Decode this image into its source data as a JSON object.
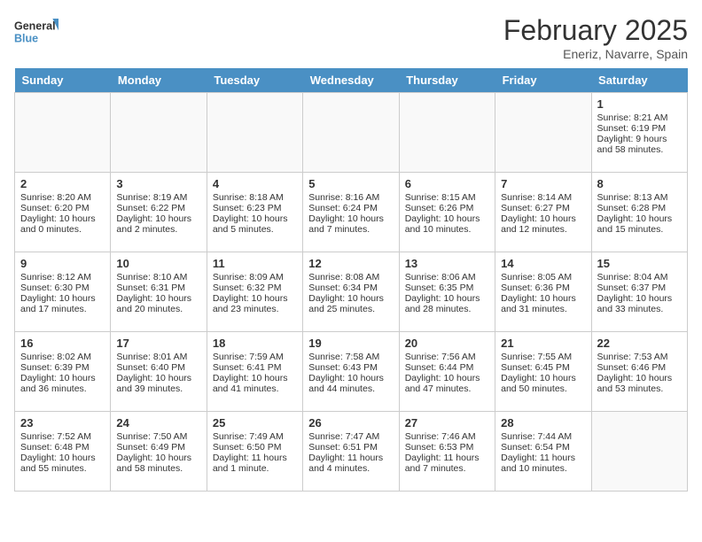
{
  "logo": {
    "line1": "General",
    "line2": "Blue"
  },
  "title": "February 2025",
  "subtitle": "Eneriz, Navarre, Spain",
  "days_of_week": [
    "Sunday",
    "Monday",
    "Tuesday",
    "Wednesday",
    "Thursday",
    "Friday",
    "Saturday"
  ],
  "weeks": [
    [
      {
        "day": "",
        "info": ""
      },
      {
        "day": "",
        "info": ""
      },
      {
        "day": "",
        "info": ""
      },
      {
        "day": "",
        "info": ""
      },
      {
        "day": "",
        "info": ""
      },
      {
        "day": "",
        "info": ""
      },
      {
        "day": "1",
        "info": "Sunrise: 8:21 AM\nSunset: 6:19 PM\nDaylight: 9 hours\nand 58 minutes."
      }
    ],
    [
      {
        "day": "2",
        "info": "Sunrise: 8:20 AM\nSunset: 6:20 PM\nDaylight: 10 hours\nand 0 minutes."
      },
      {
        "day": "3",
        "info": "Sunrise: 8:19 AM\nSunset: 6:22 PM\nDaylight: 10 hours\nand 2 minutes."
      },
      {
        "day": "4",
        "info": "Sunrise: 8:18 AM\nSunset: 6:23 PM\nDaylight: 10 hours\nand 5 minutes."
      },
      {
        "day": "5",
        "info": "Sunrise: 8:16 AM\nSunset: 6:24 PM\nDaylight: 10 hours\nand 7 minutes."
      },
      {
        "day": "6",
        "info": "Sunrise: 8:15 AM\nSunset: 6:26 PM\nDaylight: 10 hours\nand 10 minutes."
      },
      {
        "day": "7",
        "info": "Sunrise: 8:14 AM\nSunset: 6:27 PM\nDaylight: 10 hours\nand 12 minutes."
      },
      {
        "day": "8",
        "info": "Sunrise: 8:13 AM\nSunset: 6:28 PM\nDaylight: 10 hours\nand 15 minutes."
      }
    ],
    [
      {
        "day": "9",
        "info": "Sunrise: 8:12 AM\nSunset: 6:30 PM\nDaylight: 10 hours\nand 17 minutes."
      },
      {
        "day": "10",
        "info": "Sunrise: 8:10 AM\nSunset: 6:31 PM\nDaylight: 10 hours\nand 20 minutes."
      },
      {
        "day": "11",
        "info": "Sunrise: 8:09 AM\nSunset: 6:32 PM\nDaylight: 10 hours\nand 23 minutes."
      },
      {
        "day": "12",
        "info": "Sunrise: 8:08 AM\nSunset: 6:34 PM\nDaylight: 10 hours\nand 25 minutes."
      },
      {
        "day": "13",
        "info": "Sunrise: 8:06 AM\nSunset: 6:35 PM\nDaylight: 10 hours\nand 28 minutes."
      },
      {
        "day": "14",
        "info": "Sunrise: 8:05 AM\nSunset: 6:36 PM\nDaylight: 10 hours\nand 31 minutes."
      },
      {
        "day": "15",
        "info": "Sunrise: 8:04 AM\nSunset: 6:37 PM\nDaylight: 10 hours\nand 33 minutes."
      }
    ],
    [
      {
        "day": "16",
        "info": "Sunrise: 8:02 AM\nSunset: 6:39 PM\nDaylight: 10 hours\nand 36 minutes."
      },
      {
        "day": "17",
        "info": "Sunrise: 8:01 AM\nSunset: 6:40 PM\nDaylight: 10 hours\nand 39 minutes."
      },
      {
        "day": "18",
        "info": "Sunrise: 7:59 AM\nSunset: 6:41 PM\nDaylight: 10 hours\nand 41 minutes."
      },
      {
        "day": "19",
        "info": "Sunrise: 7:58 AM\nSunset: 6:43 PM\nDaylight: 10 hours\nand 44 minutes."
      },
      {
        "day": "20",
        "info": "Sunrise: 7:56 AM\nSunset: 6:44 PM\nDaylight: 10 hours\nand 47 minutes."
      },
      {
        "day": "21",
        "info": "Sunrise: 7:55 AM\nSunset: 6:45 PM\nDaylight: 10 hours\nand 50 minutes."
      },
      {
        "day": "22",
        "info": "Sunrise: 7:53 AM\nSunset: 6:46 PM\nDaylight: 10 hours\nand 53 minutes."
      }
    ],
    [
      {
        "day": "23",
        "info": "Sunrise: 7:52 AM\nSunset: 6:48 PM\nDaylight: 10 hours\nand 55 minutes."
      },
      {
        "day": "24",
        "info": "Sunrise: 7:50 AM\nSunset: 6:49 PM\nDaylight: 10 hours\nand 58 minutes."
      },
      {
        "day": "25",
        "info": "Sunrise: 7:49 AM\nSunset: 6:50 PM\nDaylight: 11 hours\nand 1 minute."
      },
      {
        "day": "26",
        "info": "Sunrise: 7:47 AM\nSunset: 6:51 PM\nDaylight: 11 hours\nand 4 minutes."
      },
      {
        "day": "27",
        "info": "Sunrise: 7:46 AM\nSunset: 6:53 PM\nDaylight: 11 hours\nand 7 minutes."
      },
      {
        "day": "28",
        "info": "Sunrise: 7:44 AM\nSunset: 6:54 PM\nDaylight: 11 hours\nand 10 minutes."
      },
      {
        "day": "",
        "info": ""
      }
    ]
  ]
}
